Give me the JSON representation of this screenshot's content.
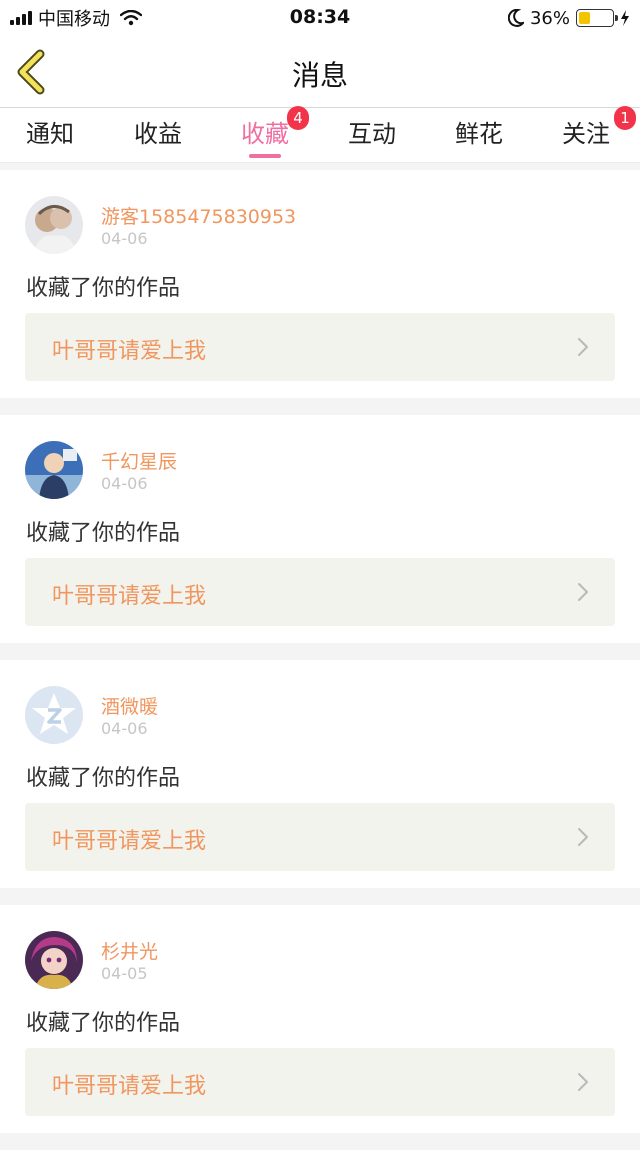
{
  "status_bar": {
    "carrier": "中国移动",
    "time": "08:34",
    "battery": "36%",
    "battery_level": 0.36,
    "icons": [
      "signal-icon",
      "wifi-icon",
      "moon-icon",
      "battery-icon",
      "charging-icon"
    ]
  },
  "header": {
    "title": "消息",
    "back_icon": "chevron-left-icon"
  },
  "tabs": [
    {
      "label": "通知",
      "badge": null
    },
    {
      "label": "收益",
      "badge": null
    },
    {
      "label": "收藏",
      "badge": "4",
      "active": true
    },
    {
      "label": "互动",
      "badge": null
    },
    {
      "label": "鲜花",
      "badge": null
    },
    {
      "label": "关注",
      "badge": "1"
    }
  ],
  "colors": {
    "accent_pink": "#ee6fa0",
    "name_orange": "#f0965e",
    "badge_red": "#f2344a",
    "box_bg": "#f3f3ed"
  },
  "feed": [
    {
      "username": "游客1585475830953",
      "date": "04-06",
      "action": "收藏了你的作品",
      "work_title": "叶哥哥请爱上我"
    },
    {
      "username": "千幻星辰",
      "date": "04-06",
      "action": "收藏了你的作品",
      "work_title": "叶哥哥请爱上我"
    },
    {
      "username": "酒微暖",
      "date": "04-06",
      "action": "收藏了你的作品",
      "work_title": "叶哥哥请爱上我"
    },
    {
      "username": "杉井光",
      "date": "04-05",
      "action": "收藏了你的作品",
      "work_title": "叶哥哥请爱上我"
    }
  ]
}
